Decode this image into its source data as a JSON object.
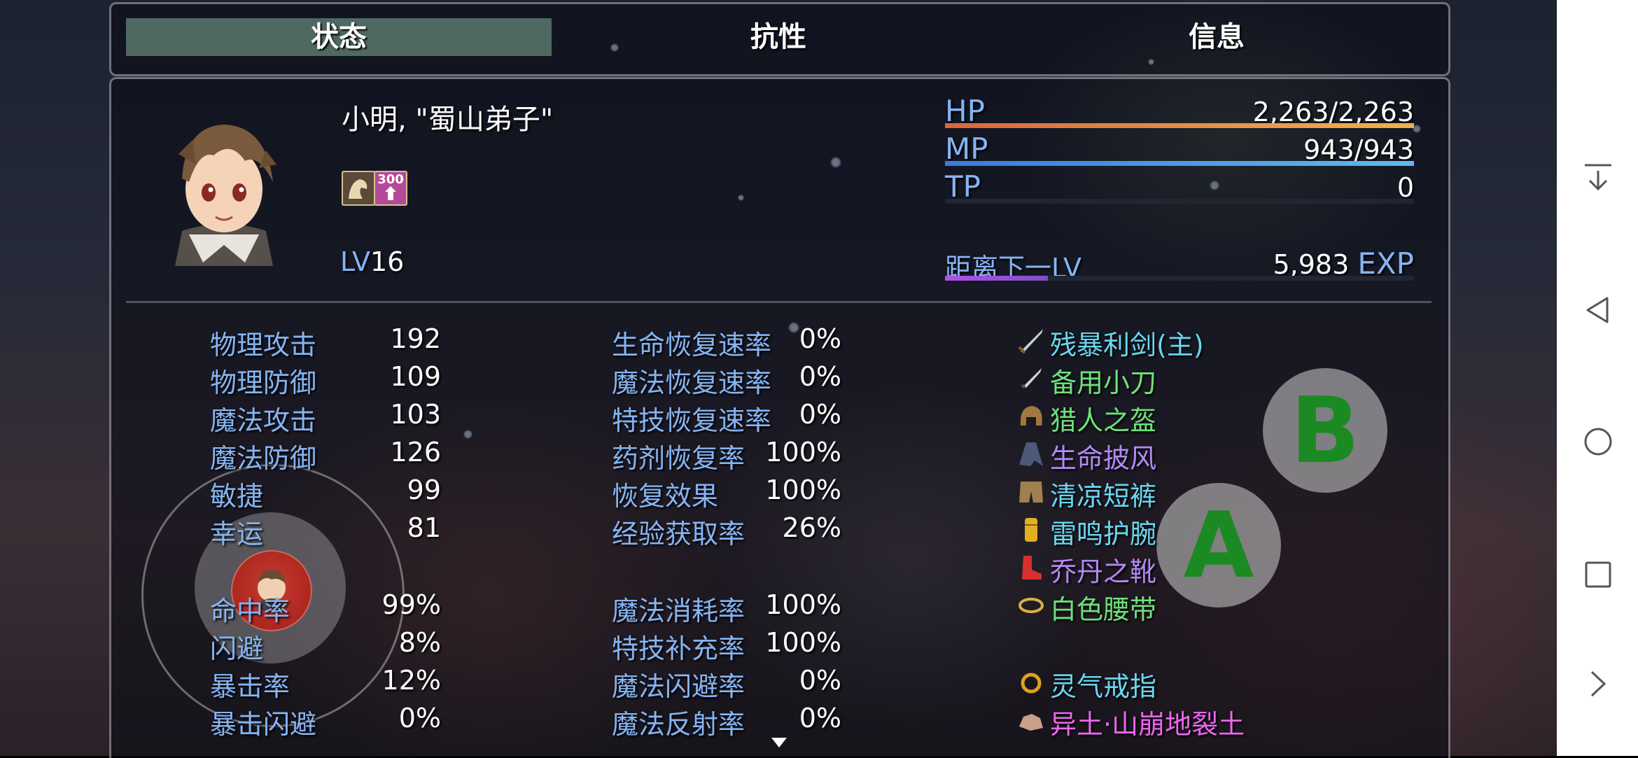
{
  "tabs": [
    {
      "label": "状态",
      "active": true
    },
    {
      "label": "抗性",
      "active": false
    },
    {
      "label": "信息",
      "active": false
    }
  ],
  "character": {
    "name": "小明, \"蜀山弟子\"",
    "level_label": "LV",
    "level": "16",
    "state_icon_text": "300"
  },
  "gauges": {
    "hp": {
      "label": "HP",
      "value": "2,263/2,263",
      "fraction": 1.0,
      "color": "#e88a3c"
    },
    "mp": {
      "label": "MP",
      "value": "943/943",
      "fraction": 1.0,
      "color": "#3c8ae8"
    },
    "tp": {
      "label": "TP",
      "value": "0",
      "fraction": 0.0,
      "color": "#3cc858"
    },
    "exp": {
      "label": "距离下一LV",
      "value": "5,983",
      "unit": "EXP",
      "color": "#b050e8"
    }
  },
  "params": [
    {
      "label": "物理攻击",
      "value": "192"
    },
    {
      "label": "物理防御",
      "value": "109"
    },
    {
      "label": "魔法攻击",
      "value": "103"
    },
    {
      "label": "魔法防御",
      "value": "126"
    },
    {
      "label": "敏捷",
      "value": "99"
    },
    {
      "label": "幸运",
      "value": "81"
    }
  ],
  "xparams": [
    {
      "label": "命中率",
      "value": "99%"
    },
    {
      "label": "闪避",
      "value": "8%"
    },
    {
      "label": "暴击率",
      "value": "12%"
    },
    {
      "label": "暴击闪避",
      "value": "0%"
    }
  ],
  "sparams_a": [
    {
      "label": "生命恢复速率",
      "value": "0%"
    },
    {
      "label": "魔法恢复速率",
      "value": "0%"
    },
    {
      "label": "特技恢复速率",
      "value": "0%"
    },
    {
      "label": "药剂恢复率",
      "value": "100%"
    },
    {
      "label": "恢复效果",
      "value": "100%"
    },
    {
      "label": "经验获取率",
      "value": "26%"
    }
  ],
  "sparams_b": [
    {
      "label": "魔法消耗率",
      "value": "100%"
    },
    {
      "label": "特技补充率",
      "value": "100%"
    },
    {
      "label": "魔法闪避率",
      "value": "0%"
    },
    {
      "label": "魔法反射率",
      "value": "0%"
    }
  ],
  "equipment": [
    {
      "name": "残暴利剑(主)",
      "icon": "sword-icon",
      "color": "#6ad6f0"
    },
    {
      "name": "备用小刀",
      "icon": "dagger-icon",
      "color": "#6fe07a"
    },
    {
      "name": "猎人之盔",
      "icon": "helmet-icon",
      "color": "#6fe07a"
    },
    {
      "name": "生命披风",
      "icon": "cloak-icon",
      "color": "#b489f5"
    },
    {
      "name": "清凉短裤",
      "icon": "shorts-icon",
      "color": "#6ad6f0"
    },
    {
      "name": "雷鸣护腕",
      "icon": "bracer-icon",
      "color": "#6ad6f0"
    },
    {
      "name": "乔丹之靴",
      "icon": "boots-icon",
      "color": "#b489f5"
    },
    {
      "name": "白色腰带",
      "icon": "belt-icon",
      "color": "#6fe07a"
    }
  ],
  "accessories": [
    {
      "name": "灵气戒指",
      "icon": "ring-icon",
      "color": "#6ad6f0"
    },
    {
      "name": "异土·山崩地裂土",
      "icon": "earth-icon",
      "color": "#ee66ee"
    }
  ],
  "controls": {
    "button_a": "A",
    "button_b": "B"
  },
  "system_nav": [
    "collapse-icon",
    "back-icon",
    "home-icon",
    "recents-icon",
    "forward-icon"
  ]
}
